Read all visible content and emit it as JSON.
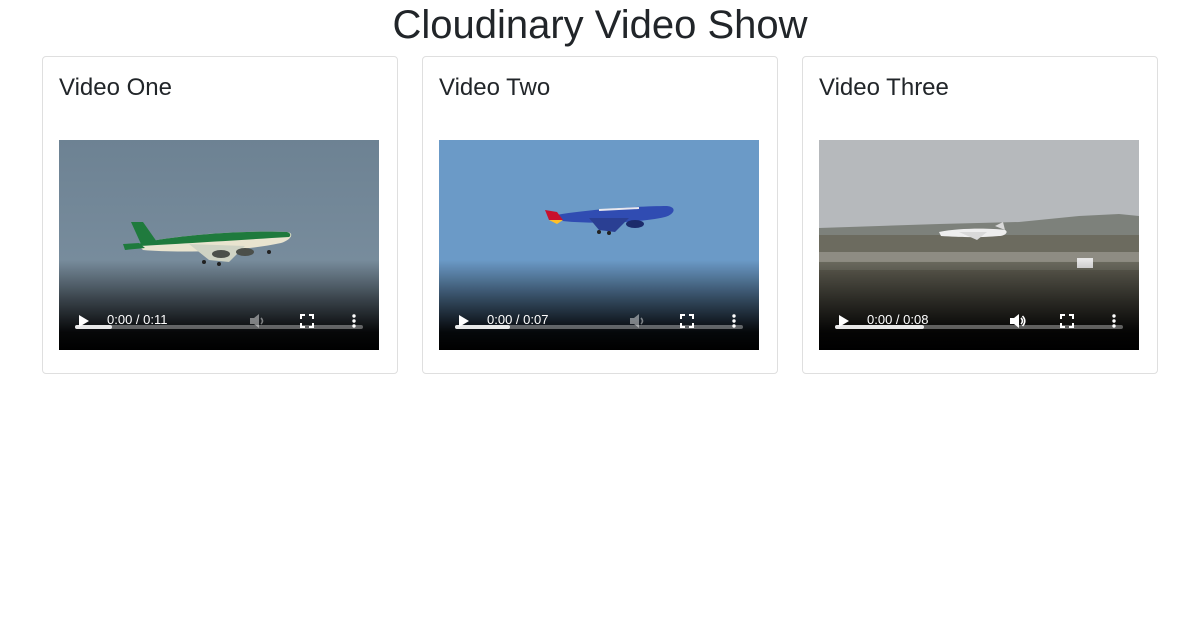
{
  "page": {
    "title": "Cloudinary Video Show"
  },
  "videos": [
    {
      "title": "Video One",
      "time": "0:00 / 0:11",
      "buffered_fraction": 0.13,
      "muted": true
    },
    {
      "title": "Video Two",
      "time": "0:00 / 0:07",
      "buffered_fraction": 0.19,
      "muted": true
    },
    {
      "title": "Video Three",
      "time": "0:00 / 0:08",
      "buffered_fraction": 0.31,
      "muted": false
    }
  ],
  "icons": {
    "play": "play-icon",
    "volume": "volume-icon",
    "fullscreen": "fullscreen-icon",
    "more": "more-options-icon"
  }
}
